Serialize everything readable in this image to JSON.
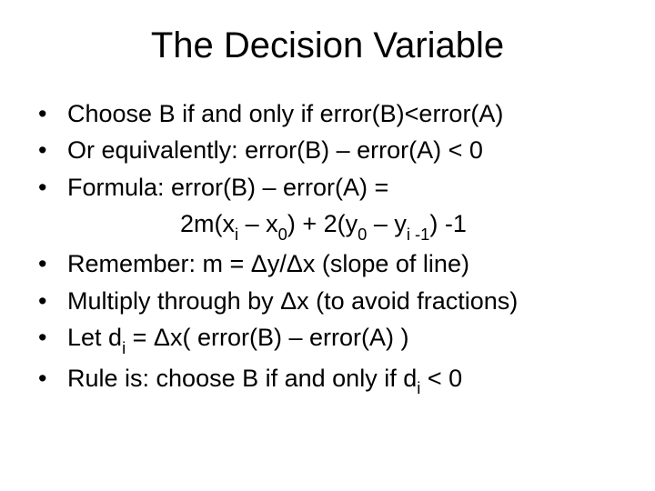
{
  "title": "The Decision Variable",
  "b1": "Choose  B  if and only if  error(B)<error(A)",
  "b2": "Or equivalently:   error(B) – error(A) < 0",
  "b3": "Formula:  error(B) – error(A) =",
  "formula_pre": "2m(x",
  "formula_s1": "i",
  "formula_mid1": " – x",
  "formula_s2": "0",
  "formula_mid2": ") + 2(y",
  "formula_s3": "0",
  "formula_mid3": " – y",
  "formula_s4": "i -1",
  "formula_end": ") -1",
  "b4": "Remember:  m = Δy/Δx  (slope of line)",
  "b5": "Multiply through by Δx (to avoid fractions)",
  "b6_pre": "Let  d",
  "b6_sub": "i",
  "b6_post": "  =  Δx( error(B) – error(A) )",
  "b7_pre": "Rule is: choose B if and only if  d",
  "b7_sub": "i",
  "b7_post": " < 0"
}
